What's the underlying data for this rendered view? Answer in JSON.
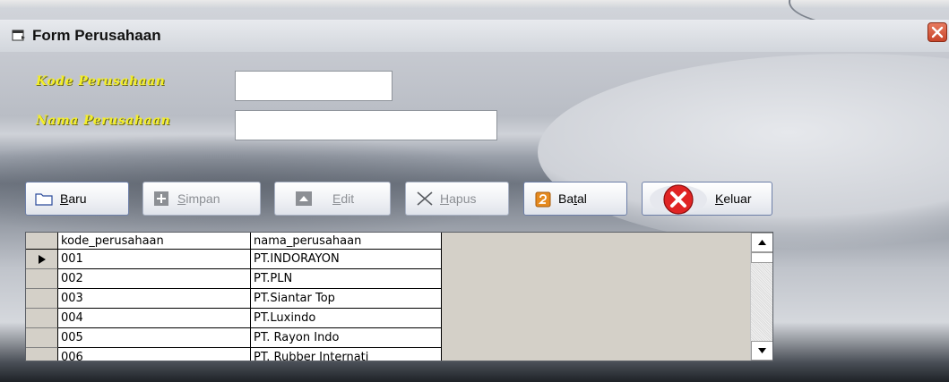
{
  "window": {
    "title": "Form Perusahaan"
  },
  "form": {
    "kode_label": "Kode Perusahaan",
    "kode_value": "",
    "nama_label": "Nama Perusahaan",
    "nama_value": ""
  },
  "toolbar": {
    "baru": {
      "pre": "",
      "u": "B",
      "post": "aru"
    },
    "simpan": {
      "pre": "",
      "u": "S",
      "post": "impan"
    },
    "edit": {
      "pre": "",
      "u": "E",
      "post": "dit"
    },
    "hapus": {
      "pre": "",
      "u": "H",
      "post": "apus"
    },
    "batal": {
      "pre": "Ba",
      "u": "t",
      "post": "al"
    },
    "keluar": {
      "pre": "",
      "u": "K",
      "post": "eluar"
    }
  },
  "grid": {
    "columns": [
      "kode_perusahaan",
      "nama_perusahaan"
    ],
    "rows": [
      {
        "kode": "001",
        "nama": "PT.INDORAYON"
      },
      {
        "kode": "002",
        "nama": "PT.PLN"
      },
      {
        "kode": "003",
        "nama": "PT.Siantar Top"
      },
      {
        "kode": "004",
        "nama": "PT.Luxindo"
      },
      {
        "kode": "005",
        "nama": "PT. Rayon Indo"
      },
      {
        "kode": "006",
        "nama": "PT. Rubber Internati"
      }
    ]
  },
  "colors": {
    "label_yellow": "#f4ee2a",
    "close_red": "#c8452a"
  }
}
